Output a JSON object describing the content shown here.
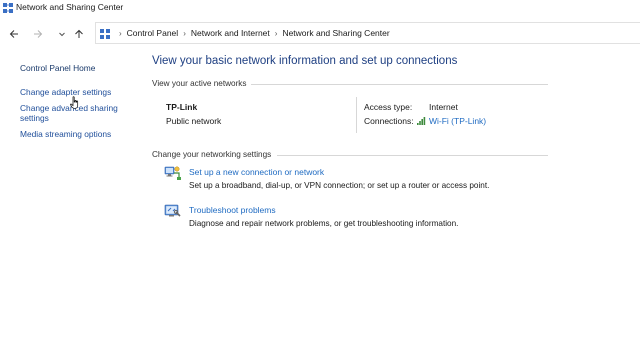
{
  "window": {
    "title": "Network and Sharing Center",
    "icon": "network-center-icon"
  },
  "nav": {
    "back_icon": "arrow-left-icon",
    "forward_icon": "arrow-right-icon",
    "up_icon": "arrow-up-icon",
    "breadcrumbs": [
      "Control Panel",
      "Network and Internet",
      "Network and Sharing Center"
    ]
  },
  "sidebar": {
    "items": [
      {
        "label": "Control Panel Home"
      },
      {
        "label": "Change adapter settings"
      },
      {
        "label": "Change advanced sharing"
      },
      {
        "label": "settings"
      },
      {
        "label": "Media streaming options"
      }
    ]
  },
  "main": {
    "title": "View your basic network information and set up connections",
    "active_networks_heading": "View your active networks",
    "network": {
      "name": "TP-Link",
      "type": "Public network",
      "access_type_label": "Access type:",
      "access_type_value": "Internet",
      "connections_label": "Connections:",
      "connections_value": "Wi-Fi (TP-Link)"
    },
    "change_settings_heading": "Change your networking settings",
    "tasks": [
      {
        "icon": "network-setup-icon",
        "link": "Set up a new connection or network",
        "desc": "Set up a broadband, dial-up, or VPN connection; or set up a router or access point."
      },
      {
        "icon": "troubleshoot-icon",
        "link": "Troubleshoot problems",
        "desc": "Diagnose and repair network problems, or get troubleshooting information."
      }
    ]
  },
  "colors": {
    "link": "#1f6bc2",
    "title": "#1e3f82",
    "sidebar_link": "#1f4e9a"
  }
}
